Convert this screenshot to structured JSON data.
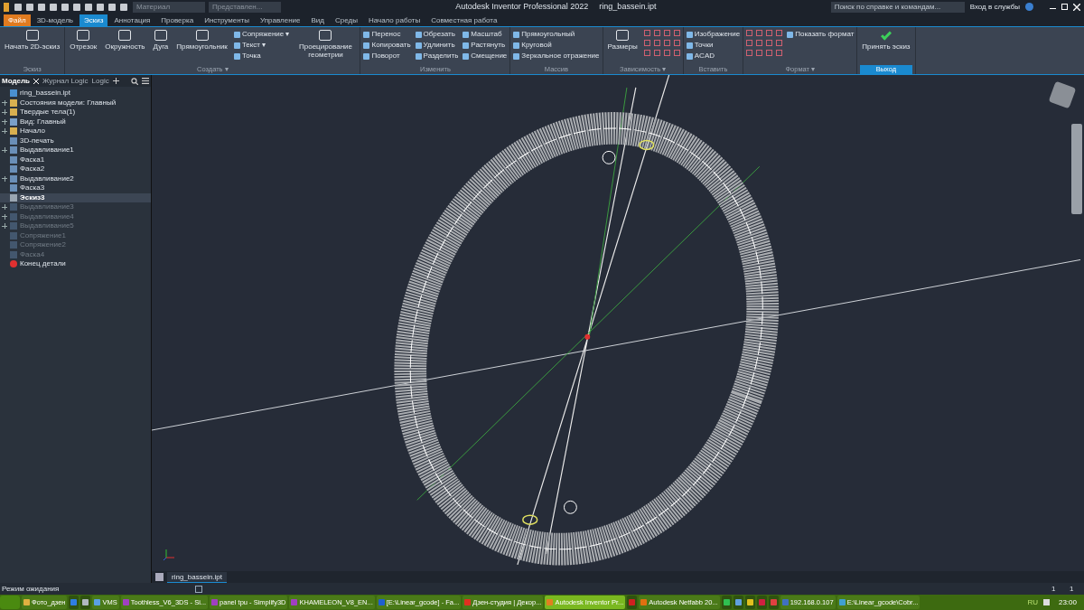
{
  "title_bar": {
    "fields": [
      {
        "placeholder": "Материал"
      },
      {
        "placeholder": "Представлен..."
      }
    ],
    "app_title": "Autodesk Inventor Professional 2022",
    "file_name": "ring_bassein.ipt",
    "search": {
      "placeholder": "Поиск по справке и командам..."
    },
    "sign_in": "Вход в службы"
  },
  "ribbon_tabs": [
    {
      "label": "Файл",
      "kind": "file",
      "selected": false
    },
    {
      "label": "3D-модель",
      "kind": "tab",
      "selected": false
    },
    {
      "label": "Эскиз",
      "kind": "tab",
      "selected": true
    },
    {
      "label": "Аннотация",
      "kind": "tab",
      "selected": false
    },
    {
      "label": "Проверка",
      "kind": "tab",
      "selected": false
    },
    {
      "label": "Инструменты",
      "kind": "tab",
      "selected": false
    },
    {
      "label": "Управление",
      "kind": "tab",
      "selected": false
    },
    {
      "label": "Вид",
      "kind": "tab",
      "selected": false
    },
    {
      "label": "Среды",
      "kind": "tab",
      "selected": false
    },
    {
      "label": "Начало работы",
      "kind": "tab",
      "selected": false
    },
    {
      "label": "Совместная работа",
      "kind": "tab",
      "selected": false
    }
  ],
  "ribbon_panels": [
    {
      "title": "Эскиз",
      "kind": "normal",
      "tools": [
        {
          "label": "Начать 2D-эскиз",
          "kind": "large"
        }
      ]
    },
    {
      "title": "Создать ▾",
      "kind": "normal",
      "tools": [
        {
          "label": "Отрезок",
          "kind": "large"
        },
        {
          "label": "Окружность",
          "kind": "large"
        },
        {
          "label": "Дуга",
          "kind": "large"
        },
        {
          "label": "Прямоугольник",
          "kind": "large"
        },
        {
          "label": "Сопряжение ▾",
          "kind": "small"
        },
        {
          "label": "Текст ▾",
          "kind": "small"
        },
        {
          "label": "Точка",
          "kind": "small"
        },
        {
          "label": "Проецирование геометрии",
          "kind": "large"
        }
      ]
    },
    {
      "title": "Изменить",
      "kind": "normal",
      "tools": [
        {
          "label": "Перенос",
          "kind": "small"
        },
        {
          "label": "Копировать",
          "kind": "small"
        },
        {
          "label": "Поворот",
          "kind": "small"
        },
        {
          "label": "Обрезать",
          "kind": "small"
        },
        {
          "label": "Удлинить",
          "kind": "small"
        },
        {
          "label": "Разделить",
          "kind": "small"
        },
        {
          "label": "Масштаб",
          "kind": "small"
        },
        {
          "label": "Растянуть",
          "kind": "small"
        },
        {
          "label": "Смещение",
          "kind": "small"
        }
      ]
    },
    {
      "title": "Массив",
      "kind": "normal",
      "tools": [
        {
          "label": "Прямоугольный",
          "kind": "small"
        },
        {
          "label": "Круговой",
          "kind": "small"
        },
        {
          "label": "Зеркальное отражение",
          "kind": "small"
        }
      ]
    },
    {
      "title": "Зависимость ▾",
      "kind": "normal",
      "tools": [
        {
          "label": "Размеры",
          "kind": "large"
        },
        {
          "kind": "grid"
        }
      ]
    },
    {
      "title": "Вставить",
      "kind": "normal",
      "tools": [
        {
          "label": "Изображение",
          "kind": "small"
        },
        {
          "label": "Точки",
          "kind": "small"
        },
        {
          "label": "ACAD",
          "kind": "small"
        }
      ]
    },
    {
      "title": "Формат ▾",
      "kind": "normal",
      "tools": [
        {
          "kind": "grid"
        },
        {
          "label": "Показать формат",
          "kind": "small"
        }
      ]
    },
    {
      "title": "Выход",
      "kind": "exit",
      "tools": [
        {
          "label": "Принять эскиз",
          "kind": "check"
        }
      ]
    }
  ],
  "browser": {
    "tabs": [
      {
        "label": "Модель",
        "selected": true
      },
      {
        "label": "Журнал Logic",
        "selected": false
      },
      {
        "label": "Logic",
        "selected": false
      }
    ],
    "items": [
      {
        "label": "ring_bassein.ipt",
        "expandable": false,
        "dimmed": false,
        "selected": false,
        "kind": "part"
      },
      {
        "label": "Состояния модели: Главный",
        "expandable": true,
        "dimmed": false,
        "selected": false,
        "kind": "folder"
      },
      {
        "label": "Твердые тела(1)",
        "expandable": true,
        "dimmed": false,
        "selected": false,
        "kind": "folder"
      },
      {
        "label": "Вид: Главный",
        "expandable": true,
        "dimmed": false,
        "selected": false,
        "kind": "view"
      },
      {
        "label": "Начало",
        "expandable": true,
        "dimmed": false,
        "selected": false,
        "kind": "folder"
      },
      {
        "label": "3D-печать",
        "expandable": false,
        "dimmed": false,
        "selected": false,
        "kind": "feature"
      },
      {
        "label": "Выдавливание1",
        "expandable": true,
        "dimmed": false,
        "selected": false,
        "kind": "feature"
      },
      {
        "label": "Фаска1",
        "expandable": false,
        "dimmed": false,
        "selected": false,
        "kind": "feature"
      },
      {
        "label": "Фаска2",
        "expandable": false,
        "dimmed": false,
        "selected": false,
        "kind": "feature"
      },
      {
        "label": "Выдавливание2",
        "expandable": true,
        "dimmed": false,
        "selected": false,
        "kind": "feature"
      },
      {
        "label": "Фаска3",
        "expandable": false,
        "dimmed": false,
        "selected": false,
        "kind": "feature"
      },
      {
        "label": "Эскиз3",
        "expandable": false,
        "dimmed": false,
        "selected": true,
        "kind": "sketch"
      },
      {
        "label": "Выдавливание3",
        "expandable": true,
        "dimmed": true,
        "selected": false,
        "kind": "feature"
      },
      {
        "label": "Выдавливание4",
        "expandable": true,
        "dimmed": true,
        "selected": false,
        "kind": "feature"
      },
      {
        "label": "Выдавливание5",
        "expandable": true,
        "dimmed": true,
        "selected": false,
        "kind": "feature"
      },
      {
        "label": "Сопряжение1",
        "expandable": false,
        "dimmed": true,
        "selected": false,
        "kind": "feature"
      },
      {
        "label": "Сопряжение2",
        "expandable": false,
        "dimmed": true,
        "selected": false,
        "kind": "feature"
      },
      {
        "label": "Фаска4",
        "expandable": false,
        "dimmed": true,
        "selected": false,
        "kind": "feature"
      },
      {
        "label": "Конец детали",
        "expandable": false,
        "dimmed": false,
        "selected": false,
        "kind": "end"
      }
    ]
  },
  "document_tab": {
    "label": "ring_bassein.ipt"
  },
  "status_bar": {
    "text": "Режим ожидания",
    "count_1": "1",
    "count_2": "1"
  },
  "taskbar": {
    "items": [
      {
        "label": "Фото_дзен",
        "active": false,
        "color": "#e0b040"
      },
      {
        "active": false,
        "color": "#2f7ee0"
      },
      {
        "active": false,
        "color": "#b0b8c0"
      },
      {
        "label": "VMS",
        "active": false,
        "color": "#5aa0e0"
      },
      {
        "label": "Toothless_V6_3DS - Si...",
        "active": false,
        "color": "#a040c0"
      },
      {
        "label": "panel tpu - Simplify3D",
        "active": false,
        "color": "#a040c0"
      },
      {
        "label": "KHAMELEON_V8_EN...",
        "active": false,
        "color": "#a040c0"
      },
      {
        "label": "[E:\\Linear_gcode] - Fa...",
        "active": false,
        "color": "#2060d0"
      },
      {
        "label": "Дзен-студия | Декор...",
        "active": false,
        "color": "#e03020"
      },
      {
        "label": "Autodesk Inventor Pr...",
        "active": true,
        "color": "#e08020"
      },
      {
        "active": false,
        "color": "#d02020"
      },
      {
        "label": "Autodesk Netfabb 20...",
        "active": false,
        "color": "#e07010"
      },
      {
        "active": false,
        "color": "#30c050"
      },
      {
        "active": false,
        "color": "#60a0e0"
      },
      {
        "active": false,
        "color": "#e0c020"
      },
      {
        "active": false,
        "color": "#d02040"
      },
      {
        "active": false,
        "color": "#e04040"
      },
      {
        "label": "192.168.0.107",
        "active": false,
        "color": "#4070c0"
      },
      {
        "label": "E:\\Linear_gcode\\Cobr...",
        "active": false,
        "color": "#40a0d0"
      }
    ],
    "language": "RU",
    "clock": "23:00"
  }
}
